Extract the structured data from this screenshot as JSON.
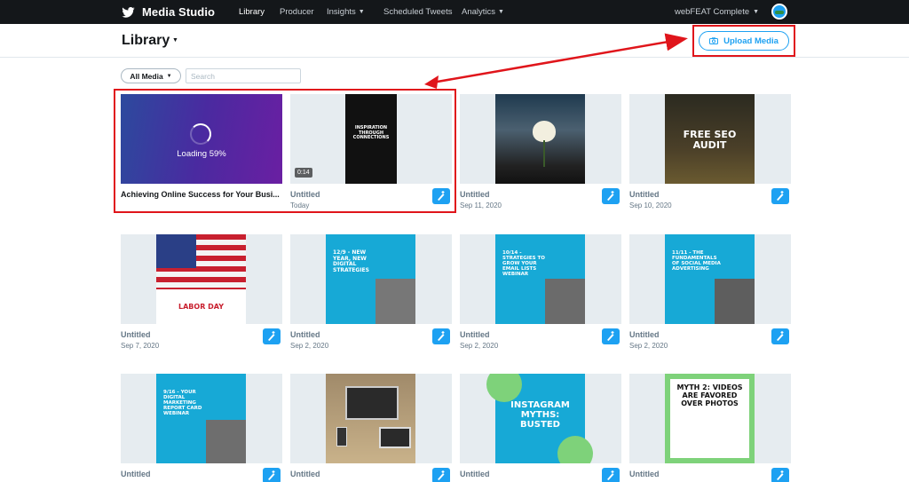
{
  "nav": {
    "brand": "Media Studio",
    "items": [
      {
        "label": "Library",
        "active": true
      },
      {
        "label": "Producer"
      },
      {
        "label": "Insights",
        "caret": true
      },
      {
        "label": "Scheduled Tweets"
      },
      {
        "label": "Analytics",
        "caret": true
      }
    ],
    "account": "webFEAT Complete"
  },
  "header": {
    "title": "Library",
    "upload_label": "Upload Media"
  },
  "filters": {
    "media_select": "All Media",
    "search_placeholder": "Search"
  },
  "cards": [
    {
      "title": "Achieving Online Success for Your Busi...",
      "date": "",
      "loading": "Loading 59%"
    },
    {
      "title": "Untitled",
      "date": "Today",
      "duration": "0:14",
      "poster": [
        "INSPIRATION",
        "THROUGH",
        "CONNECTIONS"
      ]
    },
    {
      "title": "Untitled",
      "date": "Sep 11, 2020"
    },
    {
      "title": "Untitled",
      "date": "Sep 10, 2020",
      "poster": [
        "FREE SEO",
        "AUDIT"
      ]
    },
    {
      "title": "Untitled",
      "date": "Sep 7, 2020",
      "poster": [
        "LABOR DAY"
      ]
    },
    {
      "title": "Untitled",
      "date": "Sep 2, 2020",
      "poster": [
        "12/9 - NEW",
        "YEAR, NEW",
        "DIGITAL",
        "STRATEGIES"
      ]
    },
    {
      "title": "Untitled",
      "date": "Sep 2, 2020",
      "poster": [
        "10/14 -",
        "STRATEGIES TO",
        "GROW YOUR",
        "EMAIL LISTS",
        "WEBINAR"
      ]
    },
    {
      "title": "Untitled",
      "date": "Sep 2, 2020",
      "poster": [
        "11/11 - THE",
        "FUNDAMENTALS",
        "OF SOCIAL MEDIA",
        "ADVERTISING"
      ]
    },
    {
      "title": "Untitled",
      "date": "",
      "poster": [
        "9/16 - YOUR",
        "DIGITAL",
        "MARKETING",
        "REPORT CARD",
        "WEBINAR"
      ]
    },
    {
      "title": "Untitled",
      "date": ""
    },
    {
      "title": "Untitled",
      "date": "",
      "poster": [
        "INSTAGRAM",
        "MYTHS:",
        "BUSTED"
      ]
    },
    {
      "title": "Untitled",
      "date": "",
      "poster": [
        "MYTH 2: VIDEOS",
        "ARE FAVORED",
        "OVER PHOTOS"
      ]
    }
  ],
  "colors": {
    "nav_bg": "#14171a",
    "accent": "#1da1f2",
    "highlight": "#e0151b"
  }
}
